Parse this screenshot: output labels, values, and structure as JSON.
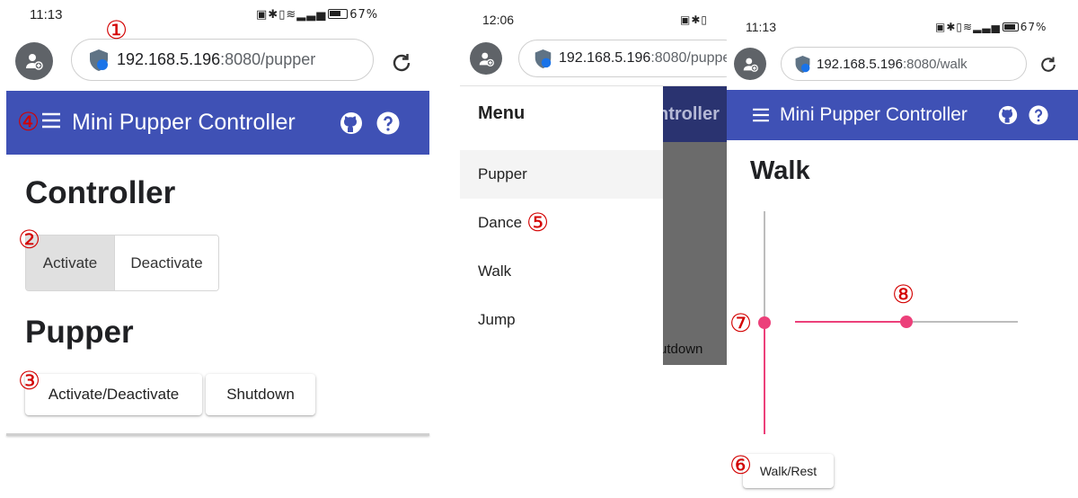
{
  "panel1": {
    "status": {
      "time": "11:13",
      "battery": "67%"
    },
    "url": {
      "host": "192.168.5.196",
      "path": ":8080/pupper"
    },
    "appbar": {
      "title": "Mini Pupper Controller"
    },
    "controller": {
      "heading": "Controller",
      "activate_label": "Activate",
      "deactivate_label": "Deactivate"
    },
    "pupper": {
      "heading": "Pupper",
      "toggle_label": "Activate/Deactivate",
      "shutdown_label": "Shutdown"
    },
    "markers": {
      "m1": "①",
      "m2": "②",
      "m3": "③",
      "m4": "④"
    }
  },
  "panel2": {
    "status": {
      "time": "12:06"
    },
    "url": {
      "host": "192.168.5.196",
      "path": ":8080/puppe"
    },
    "drawer": {
      "title": "Menu",
      "items": [
        {
          "label": "Pupper"
        },
        {
          "label": "Dance"
        },
        {
          "label": "Walk"
        },
        {
          "label": "Jump"
        }
      ]
    },
    "behind": {
      "title_fragment": "ntroller",
      "button_fragment": "utdown"
    },
    "markers": {
      "m5": "⑤"
    }
  },
  "panel3": {
    "status": {
      "time": "11:13",
      "battery": "67%"
    },
    "url": {
      "host": "192.168.5.196",
      "path": ":8080/walk"
    },
    "appbar": {
      "title": "Mini Pupper Controller"
    },
    "heading": "Walk",
    "walk_button_label": "Walk/Rest",
    "vertical_slider": {
      "value": 0.5
    },
    "horizontal_slider": {
      "value": 0.5
    },
    "markers": {
      "m6": "⑥",
      "m7": "⑦",
      "m8": "⑧"
    }
  },
  "colors": {
    "appbar": "#3f51b5",
    "slider_accent": "#ec407a",
    "marker": "#d30000"
  }
}
